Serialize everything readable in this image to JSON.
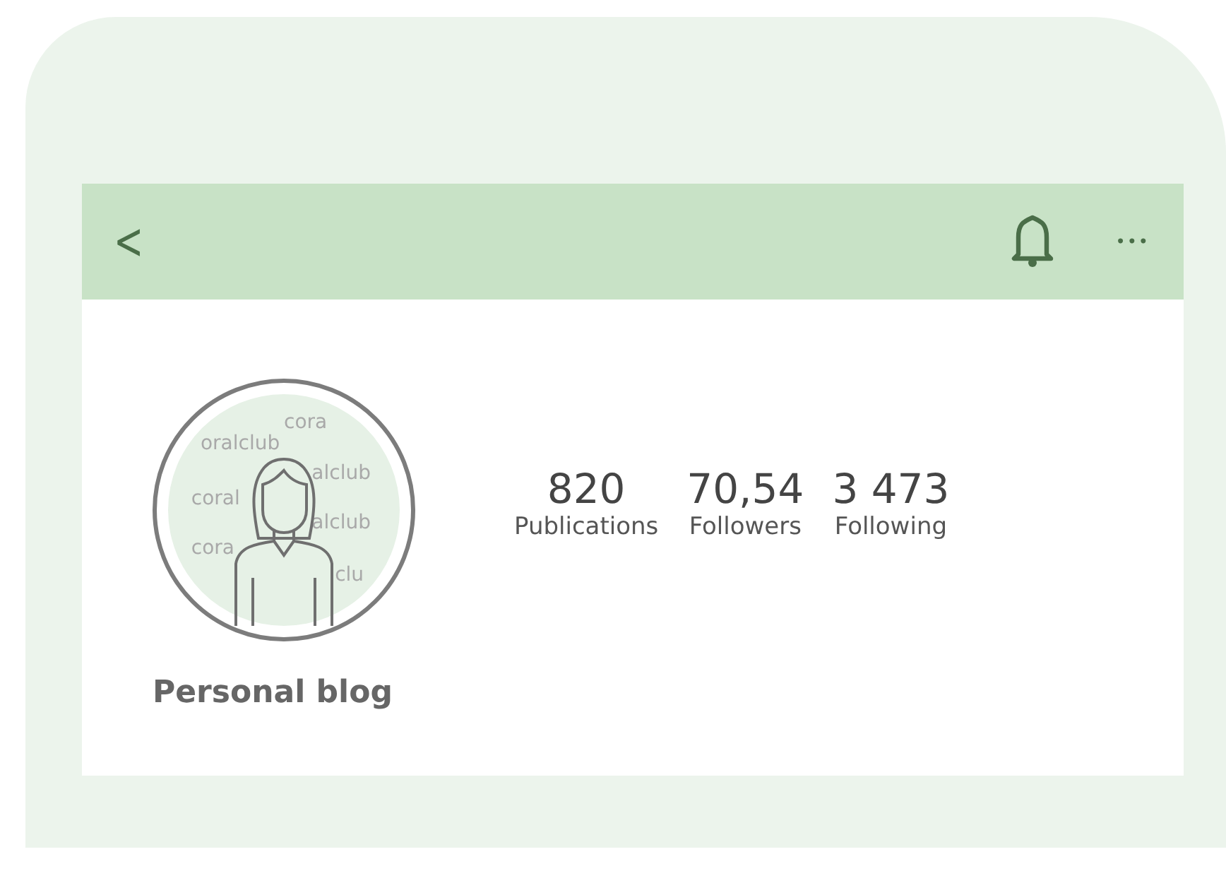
{
  "header": {
    "back_icon": "<",
    "more_icon": "•••"
  },
  "avatar": {
    "pattern_texts": [
      "cora",
      "oralclub",
      "alclub",
      "coral",
      "alclub",
      "cora",
      "clu"
    ]
  },
  "stats": [
    {
      "value": "820",
      "label": "Publications"
    },
    {
      "value": "70,54",
      "label": "Followers"
    },
    {
      "value": "3 473",
      "label": "Following"
    }
  ],
  "profile_name": "Personal blog"
}
